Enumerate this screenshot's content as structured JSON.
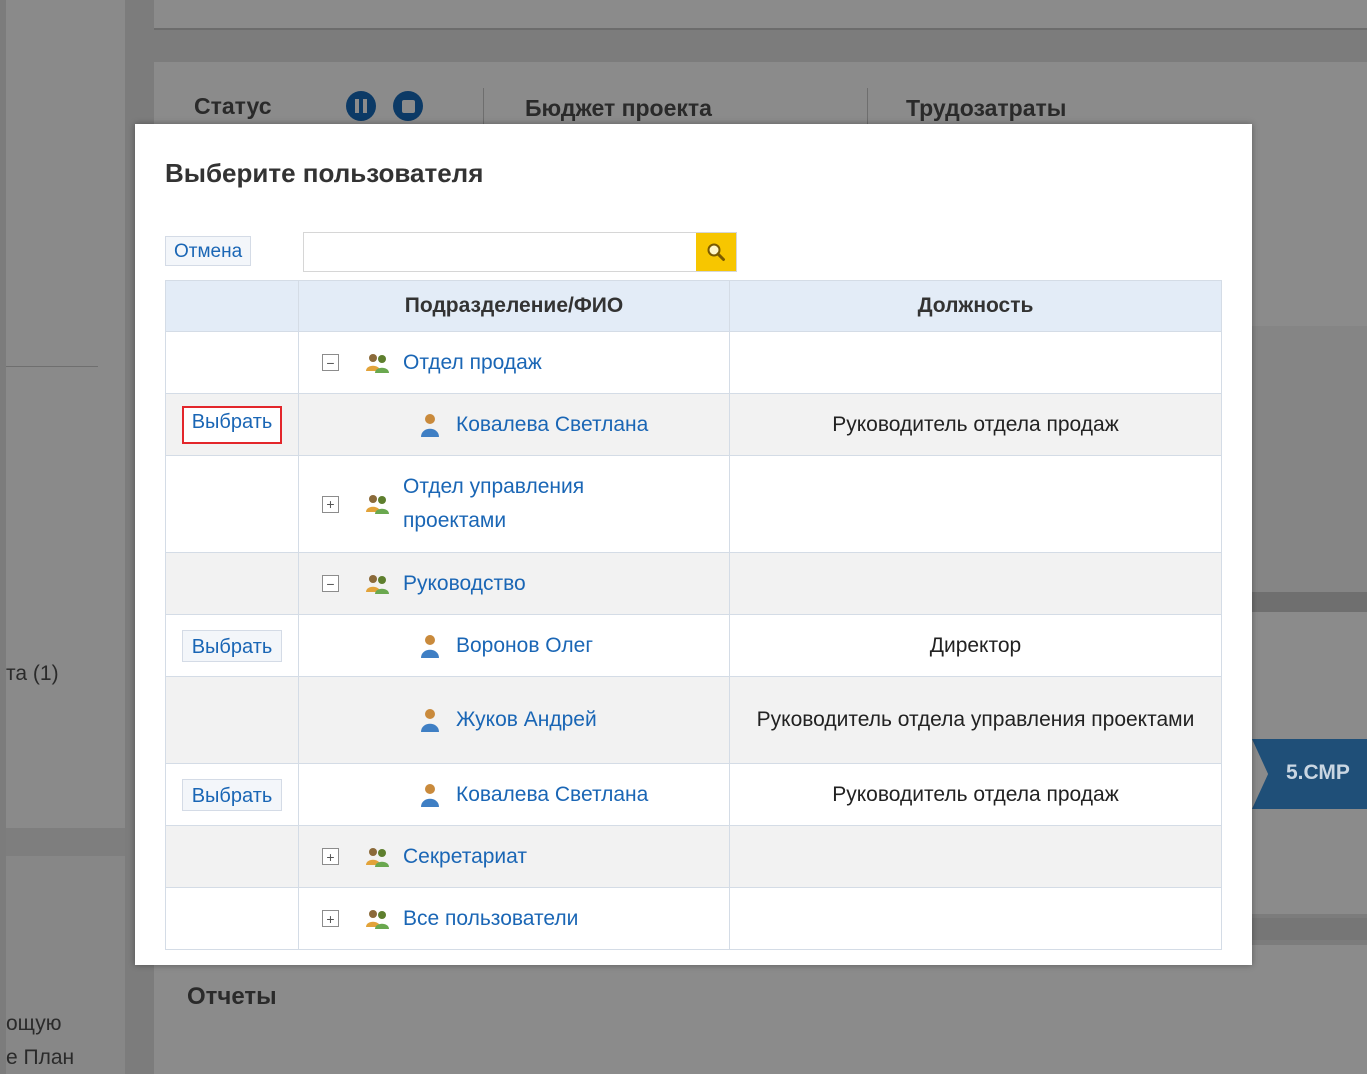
{
  "background": {
    "left_text_1": "та (1)",
    "left_text_2": "ощую",
    "left_text_3": "е План",
    "status_label": "Статус",
    "budget_label": "Бюджет проекта",
    "labor_label": "Трудозатраты",
    "reports_label": "Отчеты",
    "stage_label": "5.СМР"
  },
  "dialog": {
    "title": "Выберите пользователя",
    "cancel_label": "Отмена",
    "search": {
      "value": "",
      "placeholder": ""
    },
    "columns": [
      "",
      "Подразделение/ФИО",
      "Должность"
    ],
    "select_label": "Выбрать",
    "rows": [
      {
        "type": "department",
        "toggle": "−",
        "name": "Отдел продаж",
        "position": ""
      },
      {
        "type": "person",
        "name": "Ковалева Светлана",
        "position": "Руководитель отдела продаж",
        "select": true,
        "highlighted": true
      },
      {
        "type": "department",
        "toggle": "+",
        "name": "Отдел управления проектами",
        "position": ""
      },
      {
        "type": "department",
        "toggle": "−",
        "name": "Руководство",
        "position": ""
      },
      {
        "type": "person",
        "name": "Воронов Олег",
        "position": "Директор",
        "select": true
      },
      {
        "type": "person",
        "name": "Жуков Андрей",
        "position": "Руководитель отдела управления проектами",
        "select": false
      },
      {
        "type": "person",
        "name": "Ковалева Светлана",
        "position": "Руководитель отдела продаж",
        "select": true
      },
      {
        "type": "department",
        "toggle": "+",
        "name": "Секретариат",
        "position": ""
      },
      {
        "type": "department",
        "toggle": "+",
        "name": "Все пользователи",
        "position": ""
      }
    ]
  },
  "colors": {
    "link": "#1a66b5",
    "header_bg": "#e3ecf7",
    "search_button": "#f7c600",
    "highlight_border": "#e3262b",
    "overlay": "#7c7c7c"
  }
}
